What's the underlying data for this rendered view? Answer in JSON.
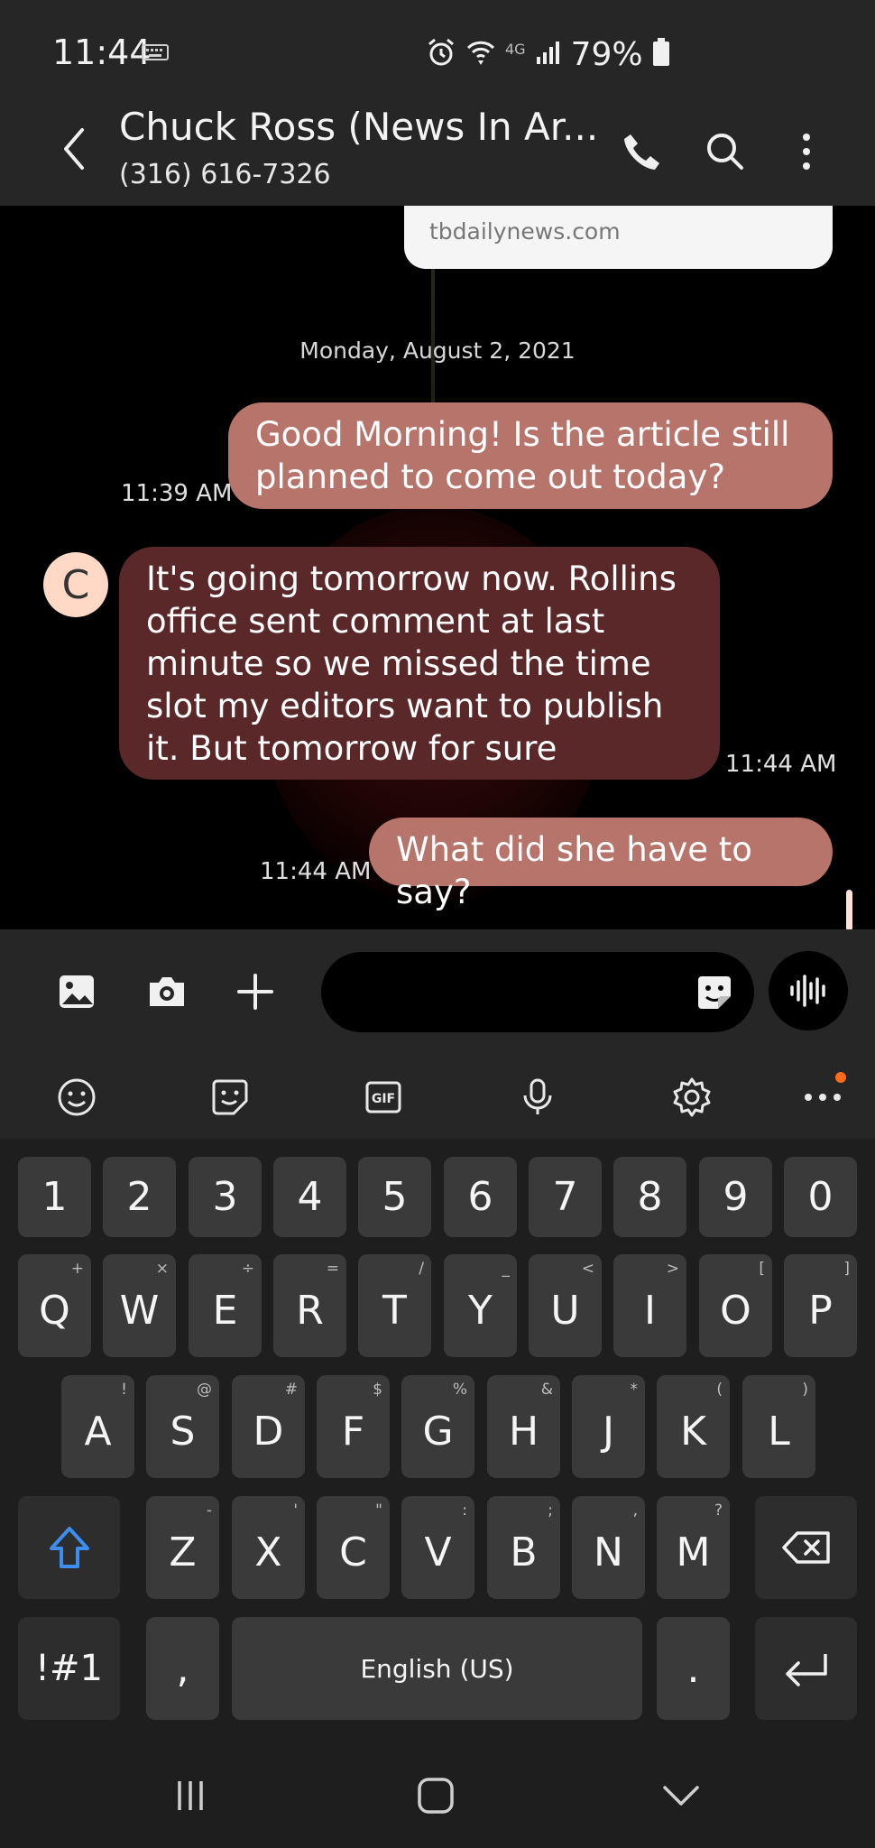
{
  "status_bar": {
    "time": "11:44",
    "network": "4G",
    "battery": "79%",
    "icons": [
      "keyboard-icon",
      "alarm-icon",
      "wifi-icon",
      "signal-icon",
      "battery-icon"
    ]
  },
  "header": {
    "contact_name": "Chuck Ross (News In Ar...",
    "contact_number": "(316) 616-7326",
    "actions": [
      "call-icon",
      "search-icon",
      "more-icon"
    ]
  },
  "conversation": {
    "link_preview_url": "tbdailynews.com",
    "date_divider": "Monday, August 2, 2021",
    "avatar_initial": "C",
    "messages": [
      {
        "direction": "sent",
        "text": "Good Morning! Is the article still planned to come out today?",
        "time": "11:39 AM"
      },
      {
        "direction": "received",
        "text": "It's going tomorrow now. Rollins office sent comment at last minute so we missed the time slot my editors want to publish it. But tomorrow for sure",
        "time": "11:44 AM"
      },
      {
        "direction": "sent",
        "text": "What did she have to say?",
        "time": "11:44 AM"
      }
    ]
  },
  "composer": {
    "input_value": "",
    "actions": [
      "gallery-icon",
      "camera-icon",
      "add-icon",
      "sticker-icon",
      "voice-record-icon"
    ]
  },
  "keyboard": {
    "toolbar": [
      "emoji-icon",
      "sticker-icon",
      "gif-icon",
      "mic-icon",
      "settings-icon",
      "more-icon"
    ],
    "gif_label": "GIF",
    "number_row": [
      "1",
      "2",
      "3",
      "4",
      "5",
      "6",
      "7",
      "8",
      "9",
      "0"
    ],
    "row1": [
      {
        "key": "Q",
        "alt": "+"
      },
      {
        "key": "W",
        "alt": "×"
      },
      {
        "key": "E",
        "alt": "÷"
      },
      {
        "key": "R",
        "alt": "="
      },
      {
        "key": "T",
        "alt": "/"
      },
      {
        "key": "Y",
        "alt": "_"
      },
      {
        "key": "U",
        "alt": "<"
      },
      {
        "key": "I",
        "alt": ">"
      },
      {
        "key": "O",
        "alt": "["
      },
      {
        "key": "P",
        "alt": "]"
      }
    ],
    "row2": [
      {
        "key": "A",
        "alt": "!"
      },
      {
        "key": "S",
        "alt": "@"
      },
      {
        "key": "D",
        "alt": "#"
      },
      {
        "key": "F",
        "alt": "$"
      },
      {
        "key": "G",
        "alt": "%"
      },
      {
        "key": "H",
        "alt": "&"
      },
      {
        "key": "J",
        "alt": "*"
      },
      {
        "key": "K",
        "alt": "("
      },
      {
        "key": "L",
        "alt": ")"
      }
    ],
    "row3": [
      {
        "key": "Z",
        "alt": "-"
      },
      {
        "key": "X",
        "alt": "'"
      },
      {
        "key": "C",
        "alt": "\""
      },
      {
        "key": "V",
        "alt": ":"
      },
      {
        "key": "B",
        "alt": ";"
      },
      {
        "key": "N",
        "alt": ","
      },
      {
        "key": "M",
        "alt": "?"
      }
    ],
    "symbols_key": "!#1",
    "comma_key": ",",
    "space_label": "English (US)",
    "period_key": "."
  },
  "nav_bar": [
    "recents-icon",
    "home-icon",
    "back-icon"
  ],
  "colors": {
    "sent_bubble": "#b6746a",
    "received_bubble": "#5a2828",
    "bar_background": "#262626",
    "keyboard_background": "#1e1e1e",
    "key_background": "#3a3a3a",
    "shift_accent": "#3d8ef0",
    "notification_dot": "#ff6b1a"
  }
}
